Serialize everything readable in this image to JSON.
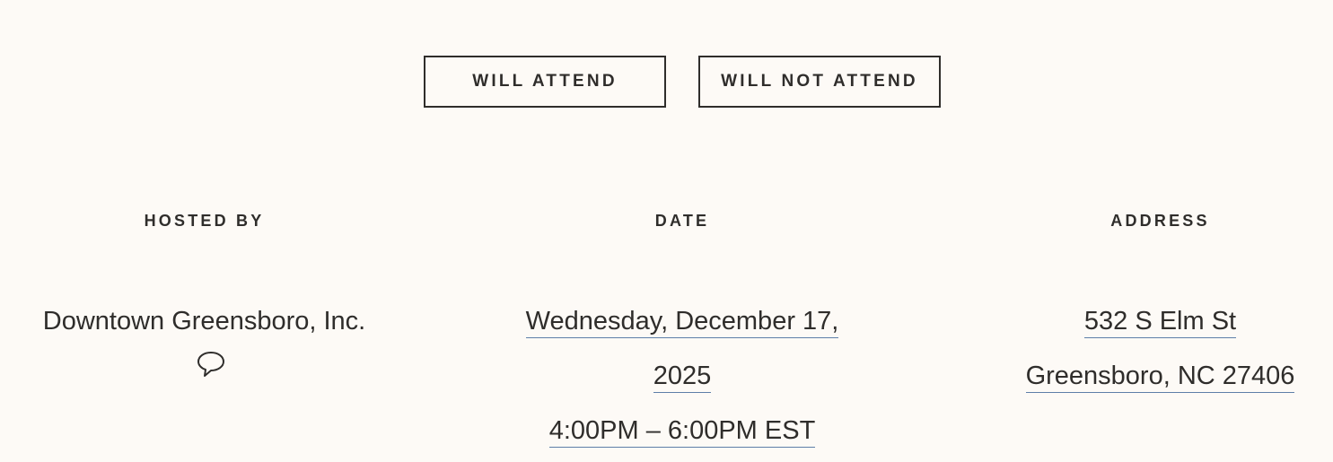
{
  "rsvp": {
    "attend_label": "WILL ATTEND",
    "not_attend_label": "WILL NOT ATTEND"
  },
  "host": {
    "label": "HOSTED BY",
    "name": "Downtown Greensboro, Inc.",
    "message_icon": "chat-bubble-icon"
  },
  "date": {
    "label": "DATE",
    "line1": "Wednesday, December 17,",
    "line2": "2025",
    "time": "4:00PM – 6:00PM EST"
  },
  "address": {
    "label": "ADDRESS",
    "street": "532 S Elm St",
    "city": "Greensboro, NC 27406"
  },
  "colors": {
    "background": "#fdfaf6",
    "text": "#2f2d2b",
    "link_underline": "#5e7fa8"
  }
}
